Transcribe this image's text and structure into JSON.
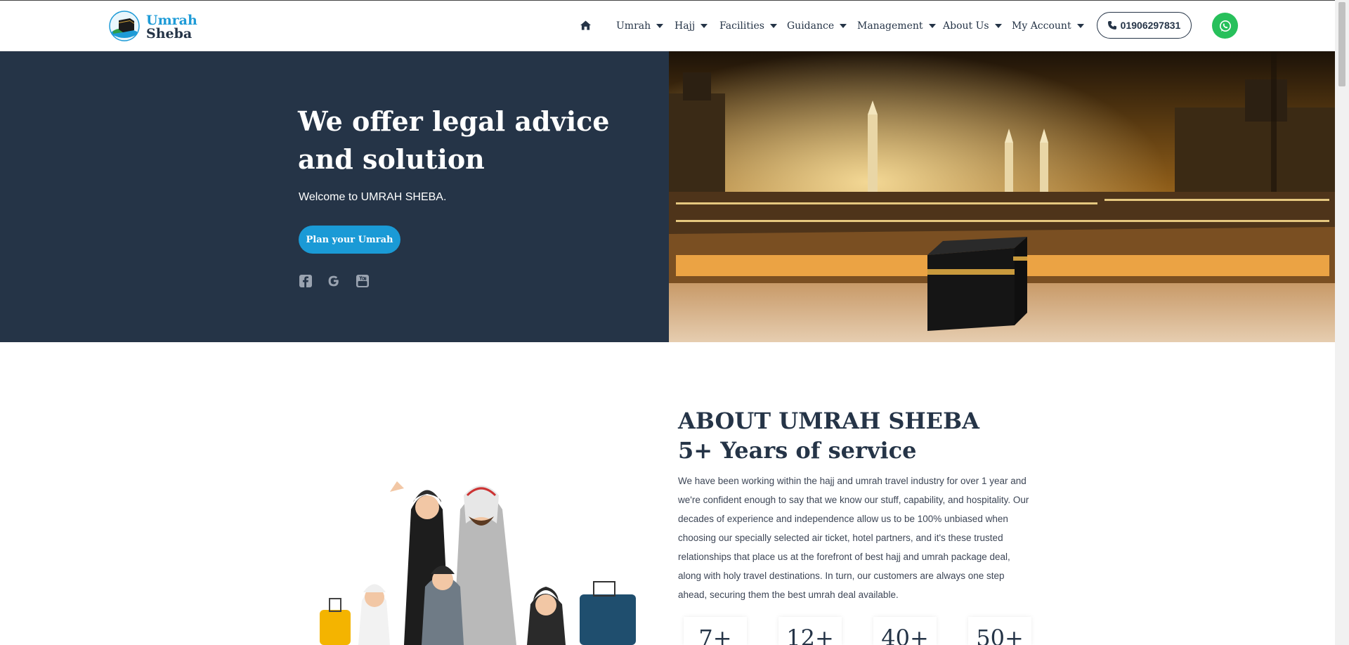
{
  "brand": {
    "line1": "Umrah",
    "line2": "Sheba"
  },
  "nav": {
    "items": [
      {
        "label": "Umrah"
      },
      {
        "label": "Hajj"
      },
      {
        "label": "Facilities"
      },
      {
        "label": "Guidance"
      },
      {
        "label": "Management"
      },
      {
        "label": "About Us"
      },
      {
        "label": "My Account"
      }
    ],
    "phone": "01906297831"
  },
  "hero": {
    "title": "We offer legal advice and solution",
    "subtitle": "Welcome to UMRAH SHEBA.",
    "cta": "Plan your Umrah",
    "social_icons": [
      "facebook-icon",
      "google-icon",
      "youtube-icon"
    ]
  },
  "about": {
    "title": "ABOUT UMRAH SHEBA 5+ Years of service",
    "body": "We have been working within the hajj and umrah travel industry for over 1 year and we're confident enough to say that we know our stuff, capability, and hospitality. Our decades of experience and independence allow us to be 100% unbiased when choosing our specially selected air ticket, hotel partners, and it's these trusted relationships that place us at the forefront of best hajj and umrah package deal, along with holy travel destinations. In turn, our customers are always one step ahead, securing them the best umrah deal available."
  },
  "stats": [
    {
      "value": "7+"
    },
    {
      "value": "12+"
    },
    {
      "value": "40+"
    },
    {
      "value": "50+"
    }
  ],
  "colors": {
    "navy": "#253447",
    "accent": "#1a9ad6",
    "whatsapp": "#27c05b"
  }
}
